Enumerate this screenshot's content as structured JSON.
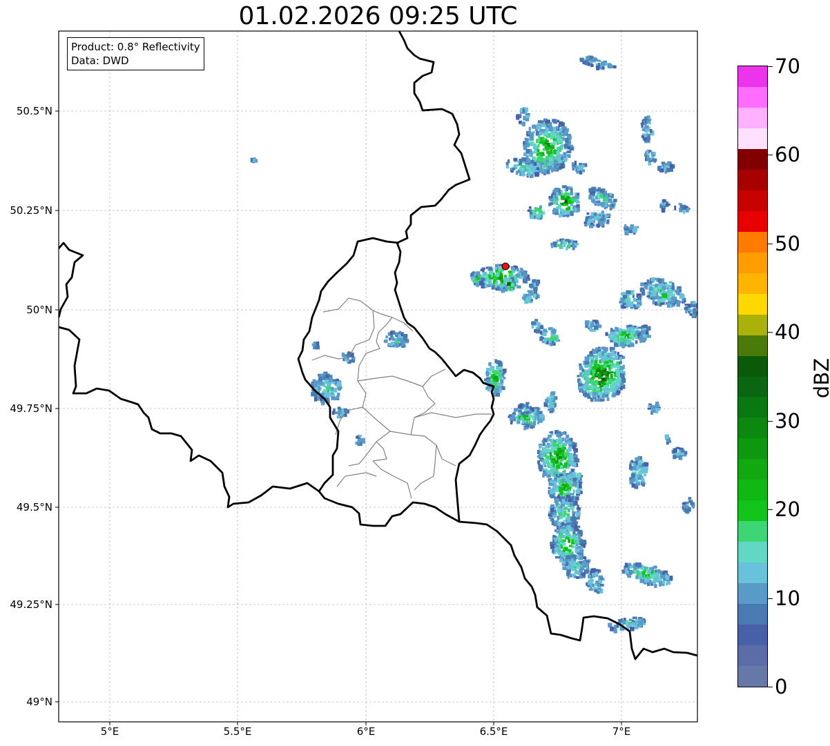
{
  "title": "01.02.2026 09:25 UTC",
  "info": {
    "product": "Product: 0.8° Reflectivity",
    "data_source": "Data: DWD"
  },
  "x_ticks": [
    "5°E",
    "5.5°E",
    "6°E",
    "6.5°E",
    "7°E"
  ],
  "y_ticks": [
    "50.5°N",
    "50.25°N",
    "50°N",
    "49.75°N",
    "49.5°N",
    "49.25°N",
    "49°N"
  ],
  "colorbar": {
    "label": "dBZ",
    "ticks": [
      "0",
      "10",
      "20",
      "30",
      "40",
      "50",
      "60",
      "70"
    ],
    "colors": [
      "#6678a8",
      "#5a6da6",
      "#4760a8",
      "#4a7ab2",
      "#5a9ac8",
      "#68c2dc",
      "#62d8c4",
      "#3ed674",
      "#12c41a",
      "#10b814",
      "#12a812",
      "#0e9810",
      "#0c8810",
      "#0a7810",
      "#0a6610",
      "#0a5a0a",
      "#4a7a0a",
      "#aab20a",
      "#ffd800",
      "#ffb400",
      "#ff9c00",
      "#ff7c00",
      "#e80000",
      "#c80000",
      "#a80000",
      "#820000",
      "#ffe0ff",
      "#ffb0ff",
      "#ff6cff",
      "#ec34ec"
    ]
  },
  "colors": {
    "border": "#000000",
    "district": "#808080",
    "radar_site": "#ee1111"
  }
}
